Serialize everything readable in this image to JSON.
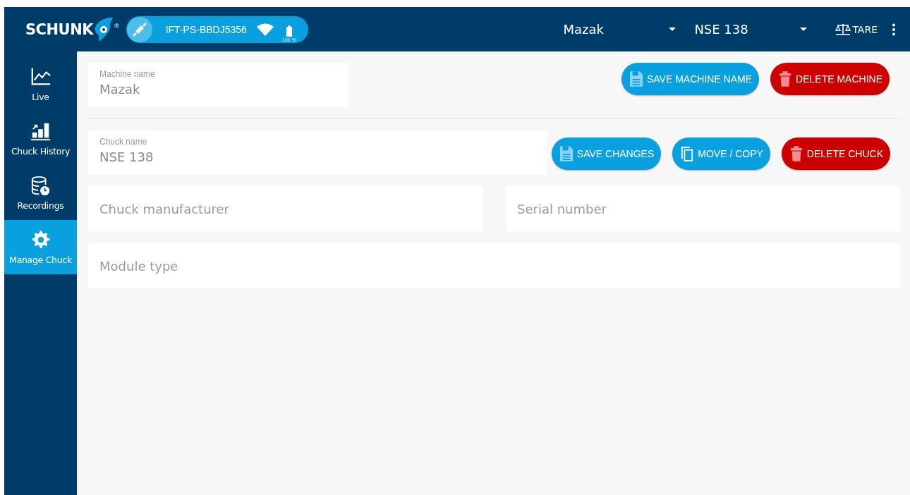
{
  "header": {
    "logo": "SCHUNK",
    "logo_mark": "®",
    "device": {
      "name": "IFT-PS-BBDJ5356",
      "battery": "100 %"
    },
    "dropdowns": [
      {
        "value": "Mazak"
      },
      {
        "value": "NSE 138"
      }
    ],
    "tare_button": "TARE"
  },
  "sidebar": {
    "items": [
      {
        "label": "Live",
        "selected": false
      },
      {
        "label": "Chuck History",
        "selected": false
      },
      {
        "label": "Recordings",
        "selected": false
      },
      {
        "label": "Manage Chuck",
        "selected": true
      }
    ]
  },
  "machine": {
    "field": {
      "label": "Machine name",
      "value": "Mazak"
    },
    "buttons": [
      {
        "label": "SAVE MACHINE NAME",
        "kind": "save"
      },
      {
        "label": "DELETE MACHINE",
        "kind": "delete"
      }
    ]
  },
  "chuck": {
    "field": {
      "label": "Chuck name",
      "value": "NSE 138"
    },
    "buttons": [
      {
        "label": "SAVE CHANGES",
        "kind": "save"
      },
      {
        "label": "MOVE / COPY",
        "kind": "copy"
      },
      {
        "label": "DELETE CHUCK",
        "kind": "delete"
      }
    ]
  },
  "details": [
    {
      "placeholder": "Chuck manufacturer"
    },
    {
      "placeholder": "Serial number"
    },
    {
      "placeholder": "Module type"
    }
  ]
}
